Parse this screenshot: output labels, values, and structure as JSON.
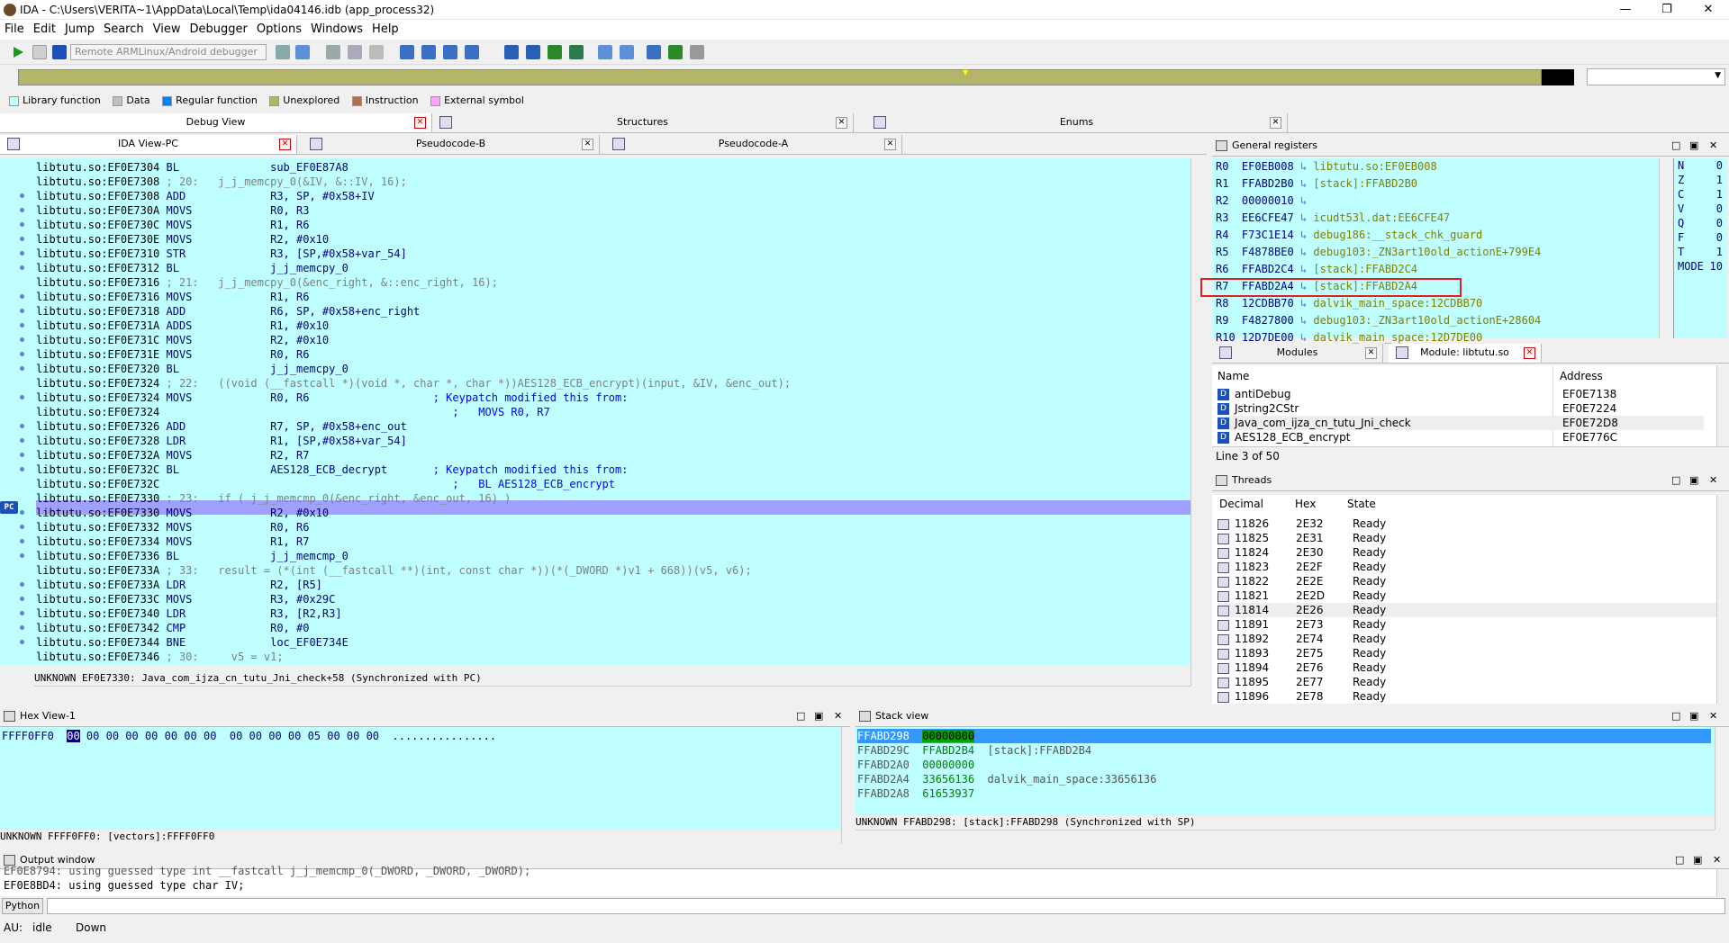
{
  "window": {
    "title": "IDA - C:\\Users\\VERITA~1\\AppData\\Local\\Temp\\ida04146.idb (app_process32)"
  },
  "menu": [
    "File",
    "Edit",
    "Jump",
    "Search",
    "View",
    "Debugger",
    "Options",
    "Windows",
    "Help"
  ],
  "toolbar": {
    "debugger_select": "Remote ARMLinux/Android debugger"
  },
  "legend": [
    {
      "label": "Library function",
      "color": "#c0ffff"
    },
    {
      "label": "Data",
      "color": "#c0c0c0"
    },
    {
      "label": "Regular function",
      "color": "#0080ff"
    },
    {
      "label": "Unexplored",
      "color": "#b5b56a"
    },
    {
      "label": "Instruction",
      "color": "#b07050"
    },
    {
      "label": "External symbol",
      "color": "#ffa0ff"
    }
  ],
  "top_tabs": [
    "Debug View",
    "Structures",
    "Enums"
  ],
  "view_tabs": [
    "IDA View-PC",
    "Pseudocode-B",
    "Pseudocode-A"
  ],
  "disasm": {
    "lines": [
      {
        "addr": "libtutu.so:EF0E7304",
        "mn": "BL",
        "op": "sub_EF0E87A8",
        "cmt": ""
      },
      {
        "addr": "libtutu.so:EF0E7308",
        "mn": "",
        "op": "",
        "cmt": "; 20:   j_j_memcpy_0(&IV, &::IV, 16);"
      },
      {
        "addr": "libtutu.so:EF0E7308",
        "mn": "ADD",
        "op": "R3, SP, #0x58+IV",
        "cmt": ""
      },
      {
        "addr": "libtutu.so:EF0E730A",
        "mn": "MOVS",
        "op": "R0, R3",
        "cmt": ""
      },
      {
        "addr": "libtutu.so:EF0E730C",
        "mn": "MOVS",
        "op": "R1, R6",
        "cmt": ""
      },
      {
        "addr": "libtutu.so:EF0E730E",
        "mn": "MOVS",
        "op": "R2, #0x10",
        "cmt": ""
      },
      {
        "addr": "libtutu.so:EF0E7310",
        "mn": "STR",
        "op": "R3, [SP,#0x58+var_54]",
        "cmt": ""
      },
      {
        "addr": "libtutu.so:EF0E7312",
        "mn": "BL",
        "op": "j_j_memcpy_0",
        "cmt": ""
      },
      {
        "addr": "libtutu.so:EF0E7316",
        "mn": "",
        "op": "",
        "cmt": "; 21:   j_j_memcpy_0(&enc_right, &::enc_right, 16);"
      },
      {
        "addr": "libtutu.so:EF0E7316",
        "mn": "MOVS",
        "op": "R1, R6",
        "cmt": ""
      },
      {
        "addr": "libtutu.so:EF0E7318",
        "mn": "ADD",
        "op": "R6, SP, #0x58+enc_right",
        "cmt": ""
      },
      {
        "addr": "libtutu.so:EF0E731A",
        "mn": "ADDS",
        "op": "R1, #0x10",
        "cmt": ""
      },
      {
        "addr": "libtutu.so:EF0E731C",
        "mn": "MOVS",
        "op": "R2, #0x10",
        "cmt": ""
      },
      {
        "addr": "libtutu.so:EF0E731E",
        "mn": "MOVS",
        "op": "R0, R6",
        "cmt": ""
      },
      {
        "addr": "libtutu.so:EF0E7320",
        "mn": "BL",
        "op": "j_j_memcpy_0",
        "cmt": ""
      },
      {
        "addr": "libtutu.so:EF0E7324",
        "mn": "",
        "op": "",
        "cmt": "; 22:   ((void (__fastcall *)(void *, char *, char *))AES128_ECB_encrypt)(input, &IV, &enc_out);"
      },
      {
        "addr": "libtutu.so:EF0E7324",
        "mn": "MOVS",
        "op": "R0, R6",
        "cmt": "; Keypatch modified this from:"
      },
      {
        "addr": "libtutu.so:EF0E7324",
        "mn": "",
        "op": "",
        "cmt": ";   MOVS R0, R7"
      },
      {
        "addr": "libtutu.so:EF0E7326",
        "mn": "ADD",
        "op": "R7, SP, #0x58+enc_out",
        "cmt": ""
      },
      {
        "addr": "libtutu.so:EF0E7328",
        "mn": "LDR",
        "op": "R1, [SP,#0x58+var_54]",
        "cmt": ""
      },
      {
        "addr": "libtutu.so:EF0E732A",
        "mn": "MOVS",
        "op": "R2, R7",
        "cmt": ""
      },
      {
        "addr": "libtutu.so:EF0E732C",
        "mn": "BL",
        "op": "AES128_ECB_decrypt",
        "cmt": "; Keypatch modified this from:"
      },
      {
        "addr": "libtutu.so:EF0E732C",
        "mn": "",
        "op": "",
        "cmt": ";   BL AES128_ECB_encrypt"
      },
      {
        "addr": "libtutu.so:EF0E7330",
        "mn": "",
        "op": "",
        "cmt": "; 23:   if ( j_j_memcmp_0(&enc_right, &enc_out, 16) )"
      },
      {
        "addr": "libtutu.so:EF0E7330",
        "mn": "MOVS",
        "op": "R2, #0x10",
        "cmt": ""
      },
      {
        "addr": "libtutu.so:EF0E7332",
        "mn": "MOVS",
        "op": "R0, R6",
        "cmt": ""
      },
      {
        "addr": "libtutu.so:EF0E7334",
        "mn": "MOVS",
        "op": "R1, R7",
        "cmt": ""
      },
      {
        "addr": "libtutu.so:EF0E7336",
        "mn": "BL",
        "op": "j_j_memcmp_0",
        "cmt": ""
      },
      {
        "addr": "libtutu.so:EF0E733A",
        "mn": "",
        "op": "",
        "cmt": "; 33:   result = (*(int (__fastcall **)(int, const char *))(*(_DWORD *)v1 + 668))(v5, v6);"
      },
      {
        "addr": "libtutu.so:EF0E733A",
        "mn": "LDR",
        "op": "R2, [R5]",
        "cmt": ""
      },
      {
        "addr": "libtutu.so:EF0E733C",
        "mn": "MOVS",
        "op": "R3, #0x29C",
        "cmt": ""
      },
      {
        "addr": "libtutu.so:EF0E7340",
        "mn": "LDR",
        "op": "R3, [R2,R3]",
        "cmt": ""
      },
      {
        "addr": "libtutu.so:EF0E7342",
        "mn": "CMP",
        "op": "R0, #0",
        "cmt": ""
      },
      {
        "addr": "libtutu.so:EF0E7344",
        "mn": "BNE",
        "op": "loc_EF0E734E",
        "cmt": ""
      },
      {
        "addr": "libtutu.so:EF0E7346",
        "mn": "",
        "op": "",
        "cmt": "; 30:     v5 = v1;"
      }
    ],
    "pc_label": "PC",
    "status": "UNKNOWN EF0E7330: Java_com_ijza_cn_tutu_Jni_check+58 (Synchronized with PC)"
  },
  "registers": {
    "title": "General registers",
    "rows": [
      {
        "name": "R0",
        "value": "EF0EB008",
        "ref": "libtutu.so:EF0EB008"
      },
      {
        "name": "R1",
        "value": "FFABD2B0",
        "ref": "[stack]:FFABD2B0"
      },
      {
        "name": "R2",
        "value": "00000010",
        "ref": ""
      },
      {
        "name": "R3",
        "value": "EE6CFE47",
        "ref": "icudt53l.dat:EE6CFE47"
      },
      {
        "name": "R4",
        "value": "F73C1E14",
        "ref": "debug186:__stack_chk_guard"
      },
      {
        "name": "R5",
        "value": "F4878BE0",
        "ref": "debug103:_ZN3art10old_actionE+799E4"
      },
      {
        "name": "R6",
        "value": "FFABD2C4",
        "ref": "[stack]:FFABD2C4"
      },
      {
        "name": "R7",
        "value": "FFABD2A4",
        "ref": "[stack]:FFABD2A4"
      },
      {
        "name": "R8",
        "value": "12CDBB70",
        "ref": "dalvik_main_space:12CDBB70"
      },
      {
        "name": "R9",
        "value": "F4827800",
        "ref": "debug103:_ZN3art10old_actionE+28604"
      },
      {
        "name": "R10",
        "value": "12D7DE00",
        "ref": "dalvik_main_space:12D7DE00"
      }
    ],
    "flags": [
      {
        "name": "N",
        "value": "0"
      },
      {
        "name": "Z",
        "value": "1"
      },
      {
        "name": "C",
        "value": "1"
      },
      {
        "name": "V",
        "value": "0"
      },
      {
        "name": "Q",
        "value": "0"
      },
      {
        "name": "F",
        "value": "0"
      },
      {
        "name": "T",
        "value": "1"
      },
      {
        "name": "MODE",
        "value": "10"
      }
    ]
  },
  "modules": {
    "tabs": [
      "Modules",
      "Module: libtutu.so"
    ],
    "columns": [
      "Name",
      "Address"
    ],
    "rows": [
      {
        "type": "D",
        "name": "antiDebug",
        "addr": "EF0E7138"
      },
      {
        "type": "D",
        "name": "Jstring2CStr",
        "addr": "EF0E7224"
      },
      {
        "type": "D",
        "name": "Java_com_ijza_cn_tutu_Jni_check",
        "addr": "EF0E72D8"
      },
      {
        "type": "D",
        "name": "AES128_ECB_encrypt",
        "addr": "EF0E776C"
      }
    ],
    "status": "Line 3 of 50"
  },
  "threads": {
    "title": "Threads",
    "columns": [
      "Decimal",
      "Hex",
      "State"
    ],
    "rows": [
      {
        "dec": "11826",
        "hex": "2E32",
        "state": "Ready"
      },
      {
        "dec": "11825",
        "hex": "2E31",
        "state": "Ready"
      },
      {
        "dec": "11824",
        "hex": "2E30",
        "state": "Ready"
      },
      {
        "dec": "11823",
        "hex": "2E2F",
        "state": "Ready"
      },
      {
        "dec": "11822",
        "hex": "2E2E",
        "state": "Ready"
      },
      {
        "dec": "11821",
        "hex": "2E2D",
        "state": "Ready"
      },
      {
        "dec": "11814",
        "hex": "2E26",
        "state": "Ready"
      },
      {
        "dec": "11891",
        "hex": "2E73",
        "state": "Ready"
      },
      {
        "dec": "11892",
        "hex": "2E74",
        "state": "Ready"
      },
      {
        "dec": "11893",
        "hex": "2E75",
        "state": "Ready"
      },
      {
        "dec": "11894",
        "hex": "2E76",
        "state": "Ready"
      },
      {
        "dec": "11895",
        "hex": "2E77",
        "state": "Ready"
      },
      {
        "dec": "11896",
        "hex": "2E78",
        "state": "Ready"
      }
    ]
  },
  "hex": {
    "title": "Hex View-1",
    "addr": "FFFF0FF0",
    "first_byte": "00",
    "bytes": " 00 00 00 00 00 00 00  00 00 00 00 05 00 00 00",
    "ascii": "................",
    "status": "UNKNOWN FFFF0FF0: [vectors]:FFFF0FF0"
  },
  "stack": {
    "title": "Stack view",
    "rows": [
      {
        "addr": "FFABD298",
        "val": "00000000",
        "ref": ""
      },
      {
        "addr": "FFABD29C",
        "val": "FFABD2B4",
        "ref": "[stack]:FFABD2B4"
      },
      {
        "addr": "FFABD2A0",
        "val": "00000000",
        "ref": ""
      },
      {
        "addr": "FFABD2A4",
        "val": "33656136",
        "ref": "dalvik_main_space:33656136"
      },
      {
        "addr": "FFABD2A8",
        "val": "61653937",
        "ref": ""
      }
    ],
    "status": "UNKNOWN FFABD298: [stack]:FFABD298 (Synchronized with SP)"
  },
  "output": {
    "title": "Output window",
    "lines": [
      "EF0E8794: using guessed type int __fastcall j_j_memcmp_0(_DWORD, _DWORD, _DWORD);",
      "EF0E8BD4: using guessed type char IV;"
    ],
    "lang_button": "Python"
  },
  "statusbar": {
    "au": "AU:",
    "state": "idle",
    "dir": "Down"
  }
}
